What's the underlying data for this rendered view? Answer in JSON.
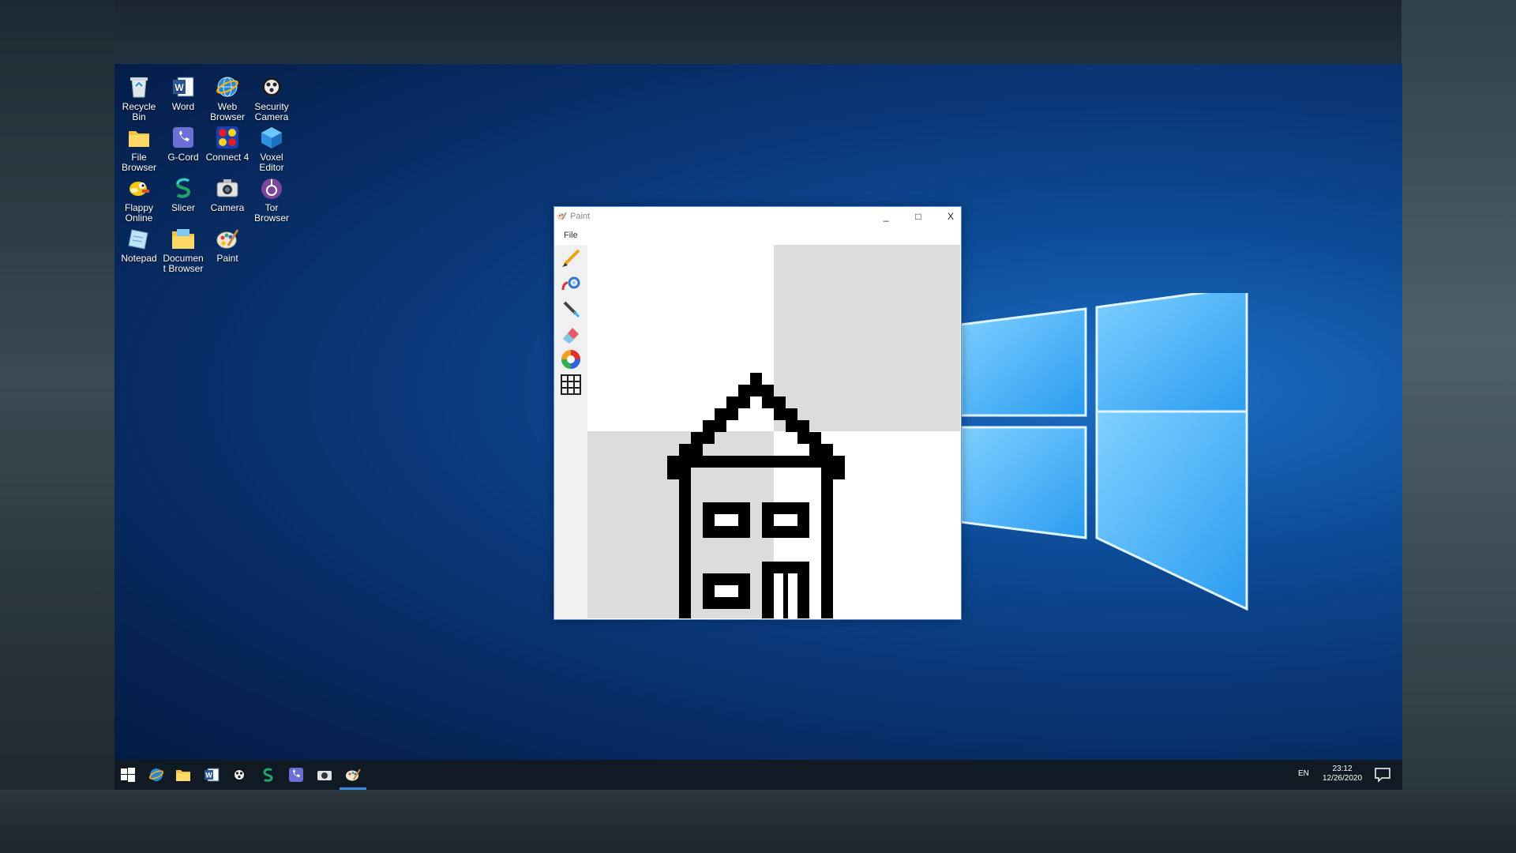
{
  "desktop": {
    "icons": [
      {
        "label": "Recycle Bin",
        "icon": "recycle-bin-icon"
      },
      {
        "label": "Word",
        "icon": "word-icon"
      },
      {
        "label": "Web Browser",
        "icon": "globe-icon"
      },
      {
        "label": "Security Camera",
        "icon": "security-camera-icon"
      },
      {
        "label": "File Browser",
        "icon": "folder-icon"
      },
      {
        "label": "G-Cord",
        "icon": "g-cord-icon"
      },
      {
        "label": "Connect 4",
        "icon": "connect4-icon"
      },
      {
        "label": "Voxel Editor",
        "icon": "cube-icon"
      },
      {
        "label": "Flappy Online",
        "icon": "flappy-bird-icon"
      },
      {
        "label": "Slicer",
        "icon": "slicer-icon"
      },
      {
        "label": "Camera",
        "icon": "camera-icon"
      },
      {
        "label": "Tor Browser",
        "icon": "tor-icon"
      },
      {
        "label": "Notepad",
        "icon": "notepad-icon"
      },
      {
        "label": "Documen t Browser",
        "icon": "document-folder-icon"
      },
      {
        "label": "Paint",
        "icon": "paint-palette-icon"
      }
    ]
  },
  "paint_window": {
    "title": "Paint",
    "minimize": "_",
    "maximize": "□",
    "close": "X",
    "menu": {
      "file": "File"
    },
    "tools": [
      "brush-icon",
      "fill-bucket-icon",
      "eyedropper-icon",
      "eraser-icon",
      "color-wheel-icon",
      "grid-icon"
    ]
  },
  "taskbar": {
    "items": [
      "start-icon",
      "web-browser-icon",
      "file-browser-icon",
      "word-icon",
      "security-camera-icon",
      "slicer-icon",
      "g-cord-icon",
      "camera-icon",
      "paint-icon"
    ],
    "active": "paint-icon",
    "language": "EN",
    "time": "23:12",
    "date": "12/26/2020"
  },
  "colors": {
    "accent": "#3a8dde",
    "taskbar": "#101a24",
    "desktop": "#0a3575"
  }
}
